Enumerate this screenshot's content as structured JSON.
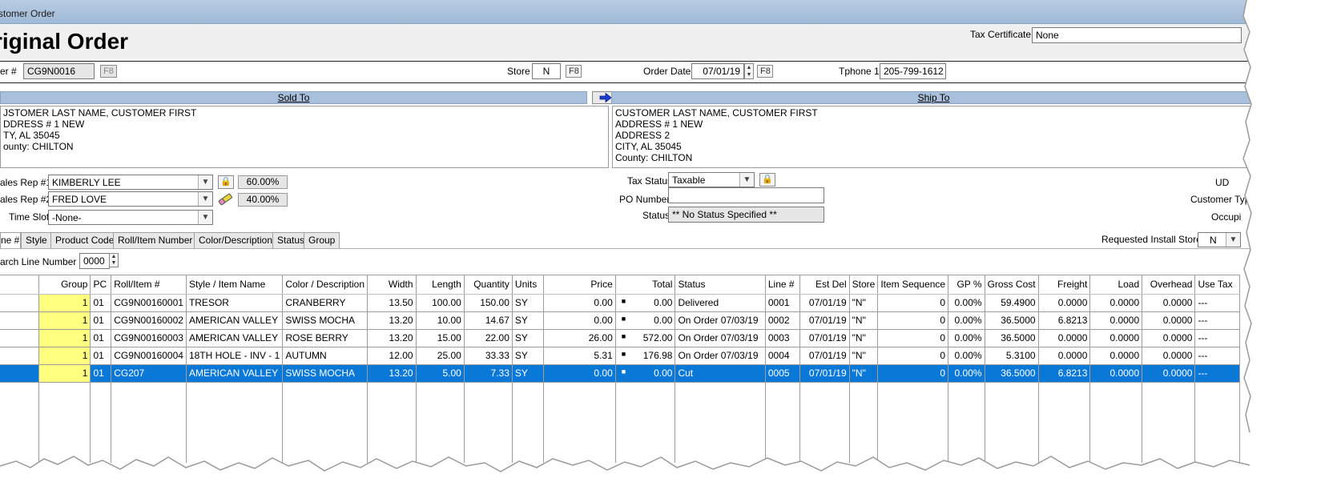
{
  "window": {
    "title": "stomer Order"
  },
  "header": {
    "title": "riginal Order",
    "tax_certificate_label": "Tax Certificate",
    "tax_certificate_value": "None"
  },
  "order": {
    "number_label": "er #",
    "number_value": "CG9N0016",
    "number_f8": "F8",
    "store_label": "Store",
    "store_value": "N",
    "store_f8": "F8",
    "date_label": "Order Date",
    "date_value": "07/01/19",
    "date_f8": "F8",
    "phone_label": "Tphone 1",
    "phone_value": "205-799-1612"
  },
  "sold_to": {
    "header": "Sold To",
    "lines": [
      "JSTOMER LAST NAME, CUSTOMER FIRST",
      "DDRESS # 1 NEW",
      "TY, AL  35045",
      "ounty: CHILTON"
    ]
  },
  "ship_to": {
    "header": "Ship To",
    "lines": [
      "CUSTOMER LAST NAME, CUSTOMER FIRST",
      "ADDRESS # 1 NEW",
      "ADDRESS 2",
      "CITY, AL  35045",
      "County: CHILTON"
    ]
  },
  "reps": {
    "rep1_label": "ales Rep #1",
    "rep1_value": "KIMBERLY LEE",
    "rep1_pct": "60.00%",
    "rep2_label": "ales Rep #2",
    "rep2_value": "FRED LOVE",
    "rep2_pct": "40.00%",
    "timeslot_label": "Time Slot",
    "timeslot_value": "-None-"
  },
  "tax": {
    "status_label": "Tax Status",
    "status_value": "Taxable",
    "po_label": "PO Number",
    "po_value": "",
    "order_status_label": "Status",
    "order_status_value": "** No Status Specified **",
    "ud_label": "UD",
    "customer_type_label": "Customer Typ",
    "occupied_label": "Occupi"
  },
  "tabs": [
    "ne #",
    "Style",
    "Product Code",
    "Roll/Item Number",
    "Color/Description",
    "Status",
    "Group"
  ],
  "install_store": {
    "label": "Requested Install Store",
    "value": "N"
  },
  "search_line": {
    "label": "arch Line Number",
    "value": "0000"
  },
  "grid": {
    "columns": [
      "Group",
      "PC",
      "Roll/Item #",
      "Style / Item Name",
      "Color / Description",
      "Width",
      "Length",
      "Quantity",
      "Units",
      "Price",
      "Total",
      "Status",
      "Line #",
      "Est Del",
      "Store",
      "Item Sequence",
      "GP %",
      "Gross Cost",
      "Freight",
      "Load",
      "Overhead",
      "Use Tax"
    ],
    "rows": [
      [
        "1",
        "01",
        "CG9N00160001",
        "TRESOR",
        "CRANBERRY",
        "13.50",
        "100.00",
        "150.00",
        "SY",
        "0.00",
        "0.00",
        "Delivered",
        "0001",
        "07/01/19",
        "\"N\"",
        "0",
        "0.00%",
        "59.4900",
        "0.0000",
        "0.0000",
        "0.0000",
        "---"
      ],
      [
        "1",
        "01",
        "CG9N00160002",
        "AMERICAN VALLEY",
        "SWISS MOCHA",
        "13.20",
        "10.00",
        "14.67",
        "SY",
        "0.00",
        "0.00",
        "On Order 07/03/19",
        "0002",
        "07/01/19",
        "\"N\"",
        "0",
        "0.00%",
        "36.5000",
        "6.8213",
        "0.0000",
        "0.0000",
        "---"
      ],
      [
        "1",
        "01",
        "CG9N00160003",
        "AMERICAN VALLEY",
        "ROSE BERRY",
        "13.20",
        "15.00",
        "22.00",
        "SY",
        "26.00",
        "572.00",
        "On Order 07/03/19",
        "0003",
        "07/01/19",
        "\"N\"",
        "0",
        "0.00%",
        "36.5000",
        "0.0000",
        "0.0000",
        "0.0000",
        "---"
      ],
      [
        "1",
        "01",
        "CG9N00160004",
        "18TH HOLE - INV - 1",
        "AUTUMN",
        "12.00",
        "25.00",
        "33.33",
        "SY",
        "5.31",
        "176.98",
        "On Order 07/03/19",
        "0004",
        "07/01/19",
        "\"N\"",
        "0",
        "0.00%",
        "5.3100",
        "0.0000",
        "0.0000",
        "0.0000",
        "---"
      ],
      [
        "1",
        "01",
        "CG207",
        "AMERICAN VALLEY",
        "SWISS MOCHA",
        "13.20",
        "5.00",
        "7.33",
        "SY",
        "0.00",
        "0.00",
        "Cut",
        "0005",
        "07/01/19",
        "\"N\"",
        "0",
        "0.00%",
        "36.5000",
        "6.8213",
        "0.0000",
        "0.0000",
        "---"
      ]
    ],
    "selected_row": 4
  },
  "colors": {
    "selection": "#0a78d7",
    "group_highlight": "#ffff80",
    "section_header": "#a9c0dc"
  },
  "icons": [
    "arrow-right-icon",
    "lock-icon",
    "pencil-eraser-icon",
    "spinner-icon",
    "chevron-down-icon"
  ]
}
